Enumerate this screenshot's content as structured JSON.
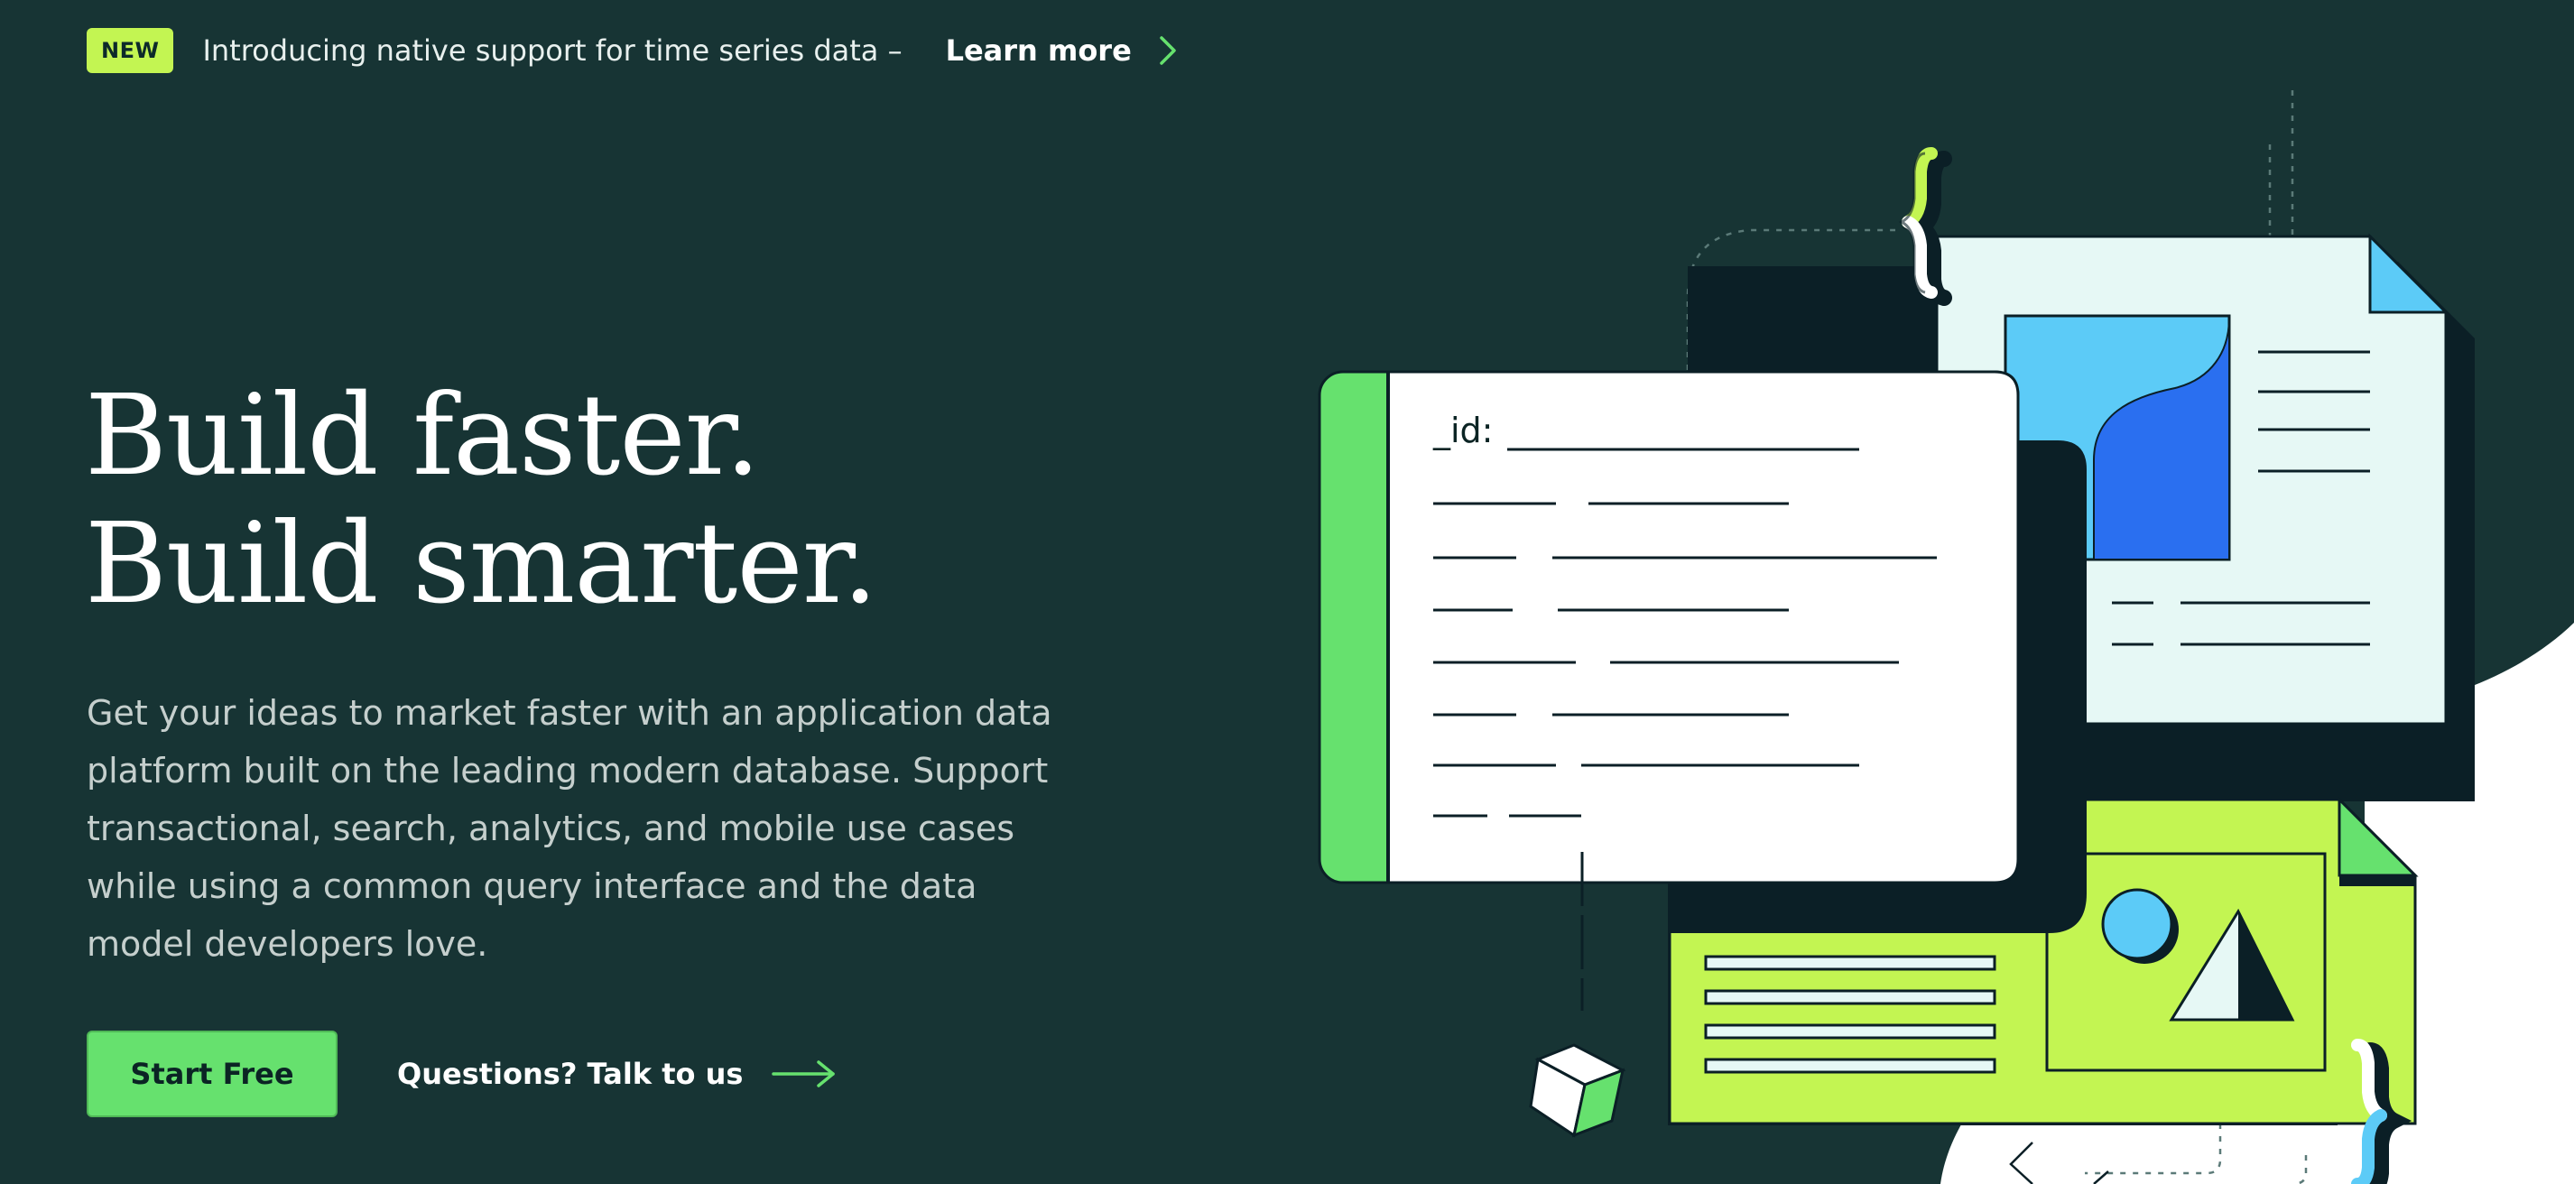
{
  "announcement": {
    "badge": "NEW",
    "text": "Introducing native support for time series data –",
    "link_label": "Learn more"
  },
  "hero": {
    "headline_line1": "Build faster.",
    "headline_line2": "Build smarter.",
    "description": "Get your ideas to market faster with an application data platform built on the leading modern database. Support transactional, search, analytics, and mobile use cases while using a common query interface and the data model developers love.",
    "primary_cta": "Start Free",
    "secondary_cta": "Questions? Talk to us"
  },
  "illustration": {
    "doc_label": "_id:"
  },
  "colors": {
    "background": "#173434",
    "accent_green": "#66e16e",
    "lime": "#c3f552",
    "blue": "#5ccbf7",
    "deep_blue": "#2a6ff0"
  },
  "icons": [
    "chevron-right-icon",
    "arrow-right-icon"
  ]
}
